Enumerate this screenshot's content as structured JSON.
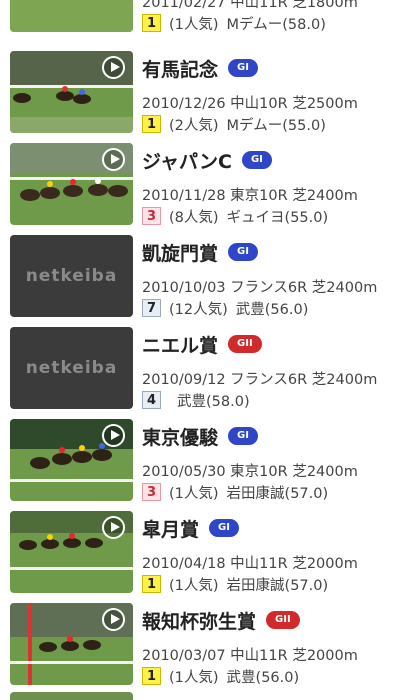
{
  "colors": {
    "grade_g1": "#2f47c7",
    "grade_g2": "#d02a2a",
    "rank1_bg": "#fff14a",
    "rank1_border": "#c9b900",
    "rank3_bg": "#ffe3e6",
    "rank3_border": "#e69aa3",
    "rank_other_bg": "#e8eef5",
    "rank_other_border": "#9aa9bb"
  },
  "top_partial": {
    "meta": "2011/02/27 中山11R 芝1800m",
    "rank": "1",
    "popularity": "(1人気)",
    "jockey": "Mデムー(58.0)"
  },
  "races": [
    {
      "name": "有馬記念",
      "grade": "GI",
      "date_course": "2010/12/26 中山10R 芝2500m",
      "rank": "1",
      "popularity": "(2人気)",
      "jockey": "Mデムー(55.0)",
      "thumb": "video",
      "scene": "rail"
    },
    {
      "name": "ジャパンC",
      "grade": "GI",
      "date_course": "2010/11/28 東京10R 芝2400m",
      "rank": "3",
      "popularity": "(8人気)",
      "jockey": "ギュイヨ(55.0)",
      "thumb": "video",
      "scene": "pack"
    },
    {
      "name": "凱旋門賞",
      "grade": "GI",
      "date_course": "2010/10/03 フランス6R 芝2400m",
      "rank": "7",
      "popularity": "(12人気)",
      "jockey": "武豊(56.0)",
      "thumb": "placeholder",
      "placeholder_text": "netkeiba"
    },
    {
      "name": "ニエル賞",
      "grade": "GII",
      "date_course": "2010/09/12 フランス6R 芝2400m",
      "rank": "4",
      "popularity": "",
      "jockey": "武豊(58.0)",
      "thumb": "placeholder",
      "placeholder_text": "netkeiba"
    },
    {
      "name": "東京優駿",
      "grade": "GI",
      "date_course": "2010/05/30 東京10R 芝2400m",
      "rank": "3",
      "popularity": "(1人気)",
      "jockey": "岩田康誠(57.0)",
      "thumb": "video",
      "scene": "crowd"
    },
    {
      "name": "皐月賞",
      "grade": "GI",
      "date_course": "2010/04/18 中山11R 芝2000m",
      "rank": "1",
      "popularity": "(1人気)",
      "jockey": "岩田康誠(57.0)",
      "thumb": "video",
      "scene": "field"
    },
    {
      "name": "報知杯弥生賞",
      "grade": "GII",
      "date_course": "2010/03/07 中山11R 芝2000m",
      "rank": "1",
      "popularity": "(1人気)",
      "jockey": "武豊(56.0)",
      "thumb": "video",
      "scene": "post"
    }
  ]
}
